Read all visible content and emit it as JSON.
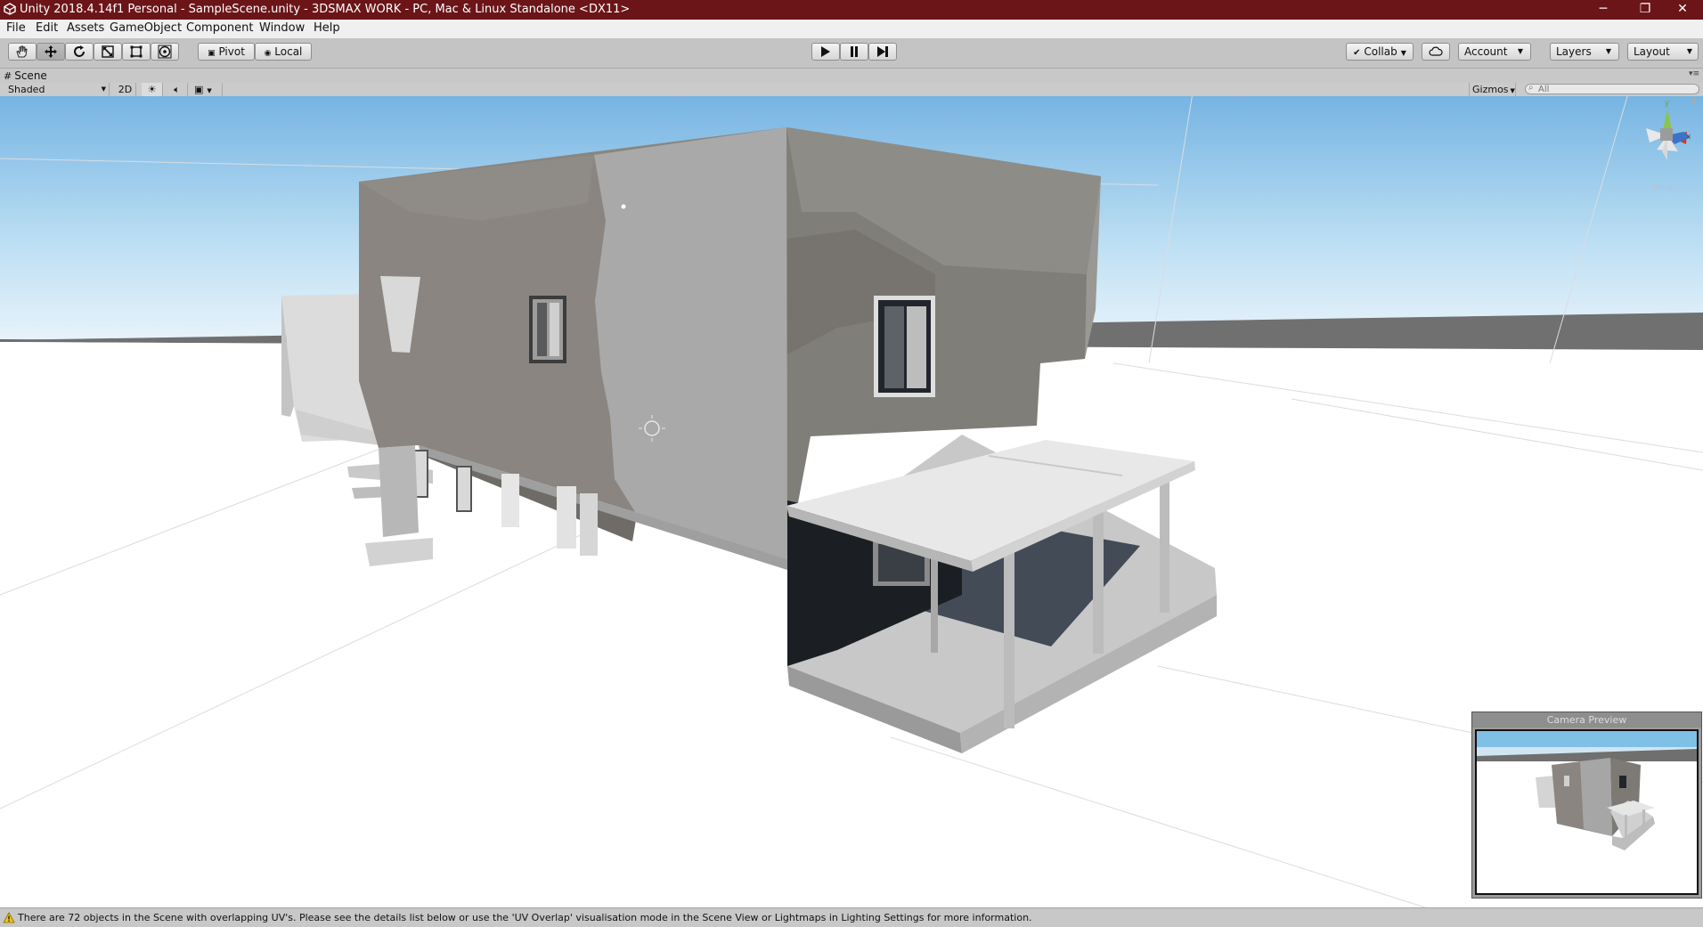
{
  "window": {
    "title": "Unity 2018.4.14f1 Personal - SampleScene.unity - 3DSMAX WORK - PC, Mac & Linux Standalone <DX11>",
    "minimize_glyph": "─",
    "maximize_glyph": "❐",
    "close_glyph": "✕"
  },
  "menu": [
    "File",
    "Edit",
    "Assets",
    "GameObject",
    "Component",
    "Window",
    "Help"
  ],
  "toolbar": {
    "tools": [
      "hand-icon",
      "move-icon",
      "rotate-icon",
      "scale-icon",
      "rect-icon",
      "transform-icon"
    ],
    "active_tool": "move-icon",
    "pivot_label": "Pivot",
    "local_label": "Local",
    "collab_label": "Collab",
    "account_label": "Account",
    "layers_label": "Layers",
    "layout_label": "Layout"
  },
  "scene_tab": {
    "label": "Scene"
  },
  "scene_toolbar": {
    "shading_mode": "Shaded",
    "mode_2d": "2D",
    "gizmos_label": "Gizmos",
    "search_placeholder": "All"
  },
  "scene_gizmo": {
    "label": "Persp"
  },
  "camera_preview": {
    "title": "Camera Preview"
  },
  "status": {
    "message": "There are 72 objects in the Scene with overlapping UV's. Please see the details list below or use the 'UV Overlap' visualisation mode in the Scene View or Lightmaps in Lighting Settings for more information."
  },
  "colors": {
    "title_bar": "#6b1519",
    "sky_top": "#78b6e3",
    "horizon": "#5e5e5e",
    "ground": "#ffffff"
  }
}
